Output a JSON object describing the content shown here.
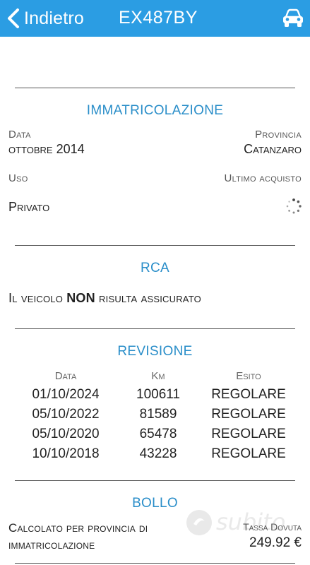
{
  "header": {
    "back_label": "Indietro",
    "plate": "EX487BY",
    "back_icon": "chevron-left-icon",
    "car_icon": "car-icon",
    "color": "#2b9de3"
  },
  "immatricolazione": {
    "title": "IMMATRICOLAZIONE",
    "data_label": "Data",
    "data_value": "ottobre 2014",
    "provincia_label": "Provincia",
    "provincia_value": "Catanzaro",
    "uso_label": "Uso",
    "uso_value": "Privato",
    "ultimo_acquisto_label": "Ultimo acquisto",
    "ultimo_acquisto_icon": "loading-spinner-icon"
  },
  "rca": {
    "title": "RCA",
    "text_before": "Il veicolo ",
    "text_bold": "NON",
    "text_after": " risulta assicurato"
  },
  "revisione": {
    "title": "REVISIONE",
    "headers": [
      "Data",
      "Km",
      "Esito"
    ],
    "rows": [
      [
        "01/10/2024",
        "100611",
        "REGOLARE"
      ],
      [
        "05/10/2022",
        "81589",
        "REGOLARE"
      ],
      [
        "05/10/2020",
        "65478",
        "REGOLARE"
      ],
      [
        "10/10/2018",
        "43228",
        "REGOLARE"
      ]
    ]
  },
  "bollo": {
    "title": "BOLLO",
    "desc_line1": "Calcolato per provincia di",
    "desc_line2": "immatricolazione",
    "tassa_label": "Tassa Dovuta",
    "tassa_value": "249.92 €"
  },
  "watermark": {
    "text": "subito"
  },
  "colors": {
    "accent": "#2b9de3",
    "section_title": "#2a8ec9"
  }
}
